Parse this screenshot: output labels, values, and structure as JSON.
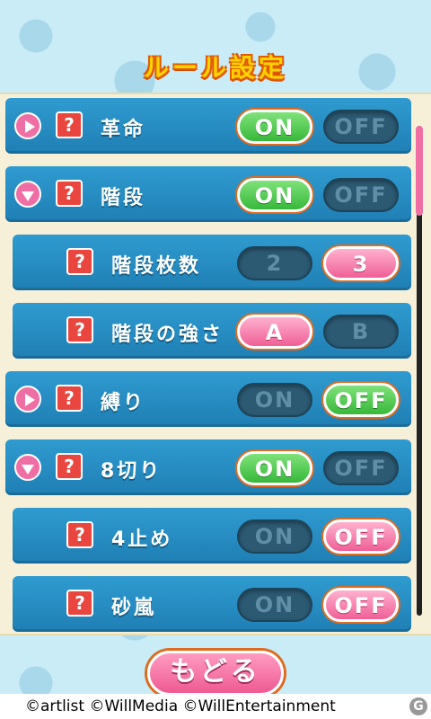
{
  "title": "ルール設定",
  "help_glyph": "?",
  "rows": [
    {
      "label": "革命",
      "expander": "right",
      "btn1": "ON",
      "btn2": "OFF"
    },
    {
      "label": "階段",
      "expander": "down",
      "btn1": "ON",
      "btn2": "OFF"
    },
    {
      "label": "階段枚数",
      "btn1": "2",
      "btn2": "3"
    },
    {
      "label": "階段の強さ",
      "btn1": "A",
      "btn2": "B"
    },
    {
      "label": "縛り",
      "expander": "right",
      "btn1": "ON",
      "btn2": "OFF"
    },
    {
      "label": "8切り",
      "expander": "down",
      "btn1": "ON",
      "btn2": "OFF"
    },
    {
      "label": "4止め",
      "btn1": "ON",
      "btn2": "OFF"
    },
    {
      "label": "砂嵐",
      "btn1": "ON",
      "btn2": "OFF"
    }
  ],
  "back_label": "もどる",
  "copyright": "©artlist ©WillMedia ©WillEntertainment",
  "colors": {
    "selected_green": "#37b83a",
    "selected_pink": "#ef5f96",
    "row_blue": "#2f9bd0"
  }
}
